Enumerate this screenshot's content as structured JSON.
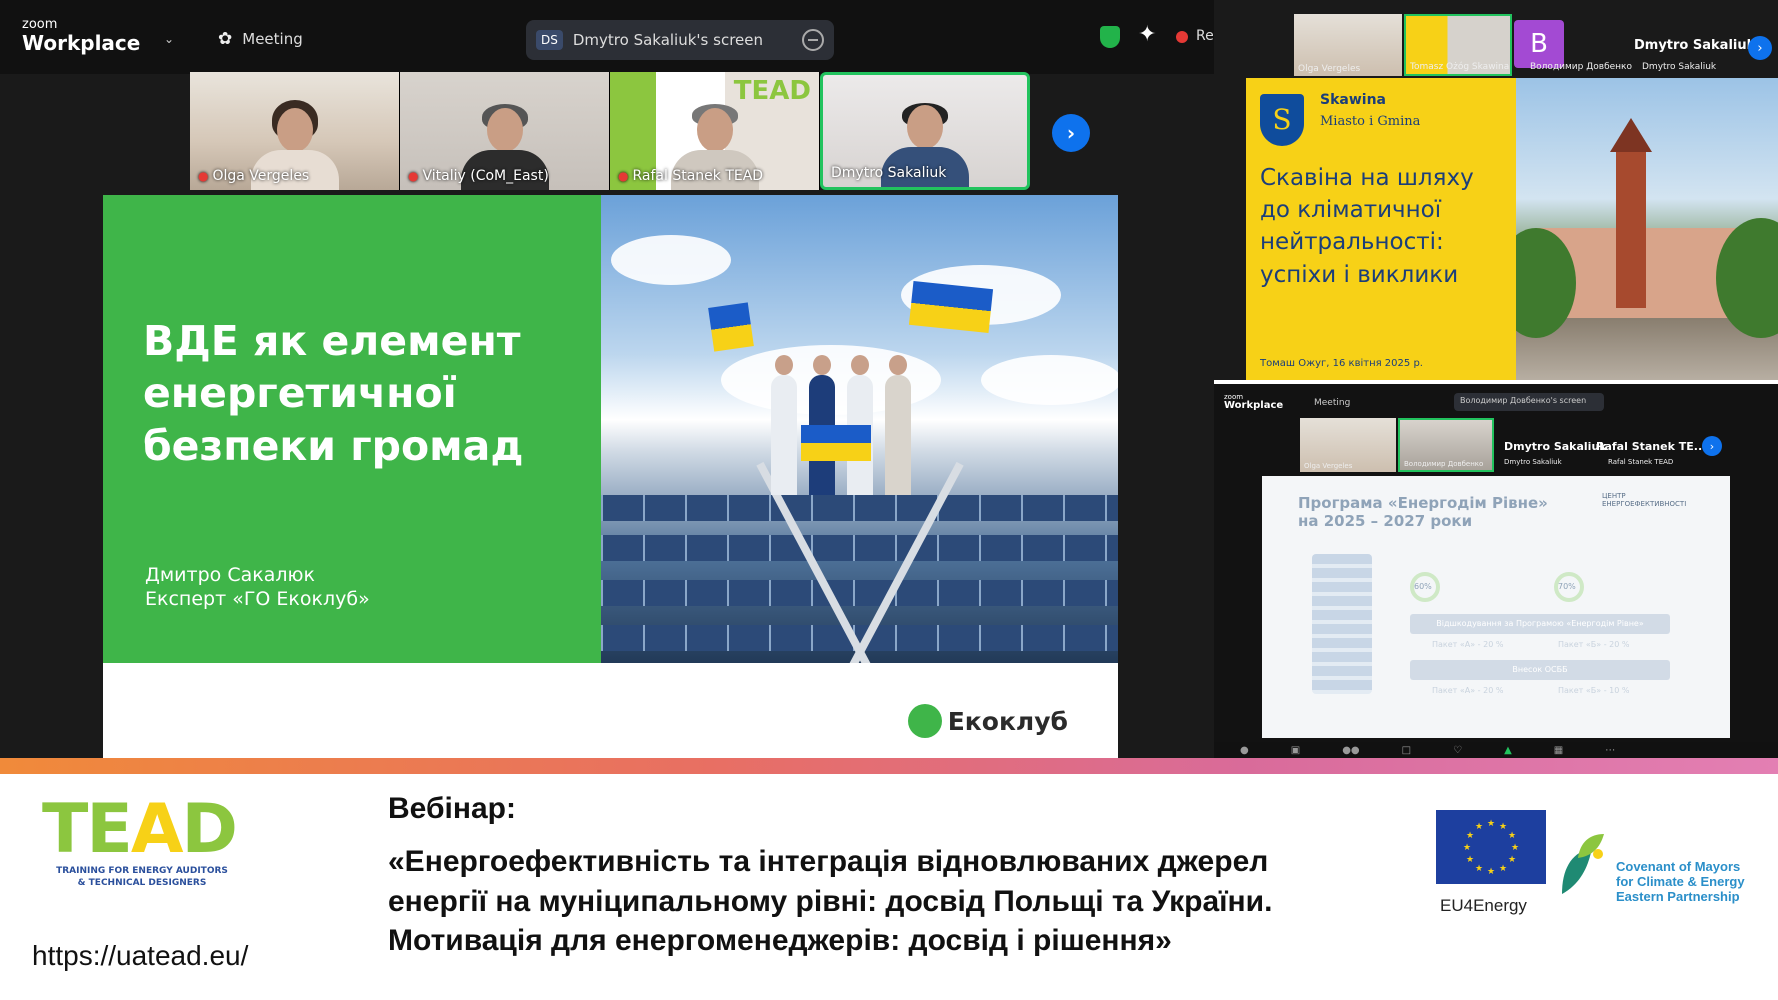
{
  "zoom": {
    "logo_top": "zoom",
    "logo_bottom": "Workplace",
    "meeting_label": "Meeting",
    "share_badge": "DS",
    "share_label": "Dmytro Sakaliuk's screen",
    "rec_label": "Re"
  },
  "participants": [
    {
      "name": "Olga Vergeles"
    },
    {
      "name": "Vitaliy (CoM_East)"
    },
    {
      "name": "Rafal Stanek TEAD"
    },
    {
      "name": "Dmytro Sakaliuk"
    }
  ],
  "main_slide": {
    "title": "ВДЕ як елемент\nенергетичної\nбезпеки громад",
    "author_line1": "Дмитро Сакалюк",
    "author_line2": "Експерт «ГО Екоклуб»",
    "logo_text": "Екоклуб",
    "thumb_logo": "TEAD"
  },
  "right_top": {
    "tiles": [
      {
        "name": "Olga Vergeles"
      },
      {
        "name": "Tomasz Ożóg Skawina"
      },
      {
        "name": "Володимир Довбенко"
      },
      {
        "name": "Dmytro Sakaliuk"
      }
    ],
    "avatar_letter": "B",
    "speaker_name": "Dmytro Sakaliuk",
    "slide": {
      "city": "Skawina",
      "subtitle": "Miasto i Gmina",
      "crest": "S",
      "title": "Скавіна на шляху\nдо кліматичної\nнейтральності:\nуспіхи і виклики",
      "footer": "Томаш Ожуг, 16 квітня 2025 р."
    }
  },
  "right_bottom": {
    "logo_top": "zoom",
    "logo_bottom": "Workplace",
    "meeting_label": "Meeting",
    "share_label": "Володимир Довбенко's screen",
    "name1": "Dmytro Sakaliuk",
    "name2": "Rafal Stanek TE...",
    "thumb_names": [
      "Olga Vergeles",
      "Володимир Довбенко"
    ],
    "sub_names": [
      "Dmytro Sakaliuk",
      "Rafal Stanek TEAD"
    ],
    "slide": {
      "title": "Програма «Енергодім Рівне»\nна 2025 – 2027 роки",
      "center_label": "ЦЕНТР ЕНЕРГОЕФЕКТИВНОСТІ",
      "ring1": "60%",
      "ring2": "70%",
      "bar1": "Відшкодування за Програмою «Енергодім Рівне»",
      "bar2": "Внесок ОСББ",
      "pkg1": "Пакет «А» - 20 %",
      "pkg2": "Пакет «Б» - 20 %",
      "pkg3": "Пакет «А» - 20 %",
      "pkg4": "Пакет «Б» - 10 %"
    }
  },
  "footer": {
    "tead_logo_text_pre": "TE",
    "tead_logo_text_a": "A",
    "tead_logo_text_post": "D",
    "tead_subtitle": "TRAINING FOR ENERGY AUDITORS\n& TECHNICAL DESIGNERS",
    "url": "https://uatead.eu/",
    "webinar_label": "Вебінар:",
    "webinar_title": "«Енергоефективність та інтеграція відновлюваних джерел\nенергії на муніципальному рівні: досвід Польщі та України.\nМотивація для енергоменеджерів: досвід і рішення»",
    "eu_label": "EU4Energy",
    "com_text": "Covenant of Mayors\nfor Climate & Energy\nEastern Partnership"
  },
  "colors": {
    "zoom_bg": "#1a1a1a",
    "slide_green": "#3fb549",
    "skawina_yellow": "#f7d117",
    "zoom_blue": "#0e72ed",
    "active_green": "#22c35e",
    "eu_blue": "#1d3f9f"
  }
}
